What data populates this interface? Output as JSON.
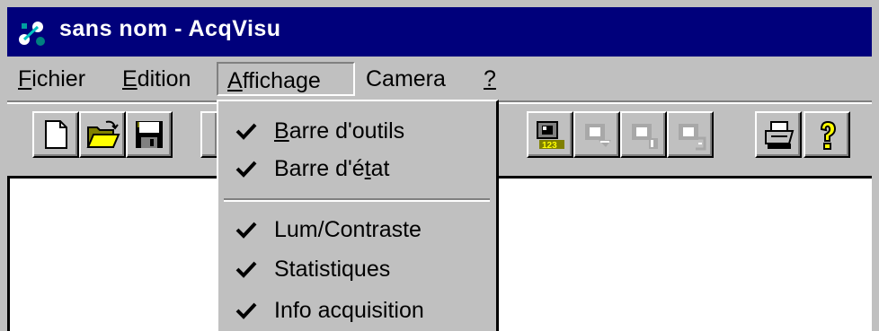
{
  "window": {
    "title": "sans nom - AcqVisu",
    "colors": {
      "titlebar": "#00007b",
      "face": "#c0c0c0",
      "client": "#ffffff"
    }
  },
  "menubar": {
    "items": [
      {
        "label": "Fichier",
        "mnemonic": "F",
        "rest": "ichier"
      },
      {
        "label": "Edition",
        "mnemonic": "E",
        "rest": "dition"
      },
      {
        "label": "Affichage",
        "mnemonic": "A",
        "rest": "ffichage"
      },
      {
        "label": "Camera",
        "mnemonic": "",
        "rest": "Camera"
      },
      {
        "label": "?",
        "mnemonic": "?",
        "rest": ""
      }
    ]
  },
  "toolbar": {
    "buttons": [
      "new-file-icon",
      "open-folder-icon",
      "save-floppy-icon",
      "camera-counter-icon",
      "camera-forward-icon",
      "camera-stop-icon",
      "camera-step-icon",
      "print-icon",
      "help-icon"
    ]
  },
  "affichage_menu": {
    "items": [
      {
        "pre": "",
        "u": "B",
        "post": "arre d'outils",
        "checked": true
      },
      {
        "pre": "Barre d'é",
        "u": "t",
        "post": "at",
        "checked": true
      },
      {
        "pre": "Lum/Contraste",
        "u": "",
        "post": "",
        "checked": true
      },
      {
        "pre": "Statistiques",
        "u": "",
        "post": "",
        "checked": true
      },
      {
        "pre": "Info acquisition",
        "u": "",
        "post": "",
        "checked": true
      }
    ]
  }
}
